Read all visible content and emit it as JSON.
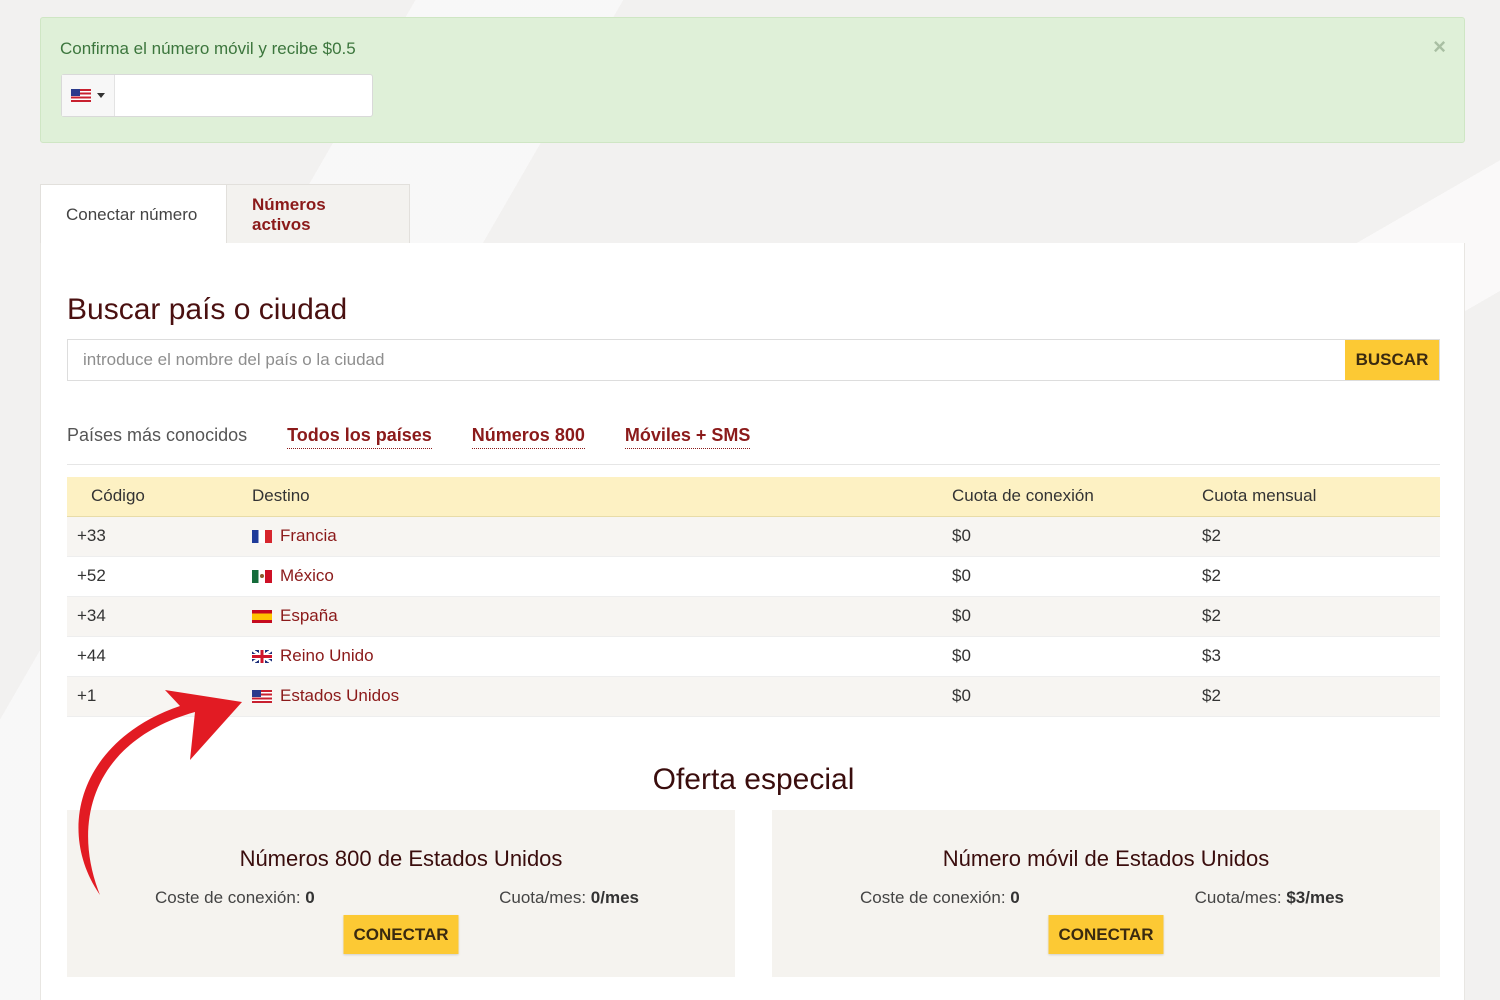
{
  "alert": {
    "message": "Confirma el número móvil y recibe $0.5",
    "close_glyph": "×",
    "phone_value": "",
    "selected_country_flag": "us-flag-icon"
  },
  "tabs": [
    {
      "label": "Conectar número",
      "active": true
    },
    {
      "label": "Números activos",
      "active": false
    }
  ],
  "search": {
    "title": "Buscar país o ciudad",
    "placeholder": "introduce el nombre del país o la ciudad",
    "button_label": "BUSCAR"
  },
  "filters": {
    "label": "Países más conocidos",
    "links": [
      "Todos los países",
      "Números 800",
      "Móviles + SMS"
    ]
  },
  "table": {
    "headers": [
      "Código",
      "Destino",
      "Cuota de conexión",
      "Cuota mensual"
    ],
    "rows": [
      {
        "code": "+33",
        "flag": "fr",
        "destination": "Francia",
        "connection": "$0",
        "monthly": "$2"
      },
      {
        "code": "+52",
        "flag": "mx",
        "destination": "México",
        "connection": "$0",
        "monthly": "$2"
      },
      {
        "code": "+34",
        "flag": "es",
        "destination": "España",
        "connection": "$0",
        "monthly": "$2"
      },
      {
        "code": "+44",
        "flag": "gb",
        "destination": "Reino Unido",
        "connection": "$0",
        "monthly": "$3"
      },
      {
        "code": "+1",
        "flag": "us",
        "destination": "Estados Unidos",
        "connection": "$0",
        "monthly": "$2"
      }
    ]
  },
  "offers": {
    "title": "Oferta especial",
    "cards": [
      {
        "title": "Números 800 de Estados Unidos",
        "conn_label": "Coste de conexión:",
        "conn_value": "0",
        "fee_label": "Cuota/mes:",
        "fee_value": "0/mes",
        "button": "CONECTAR"
      },
      {
        "title": "Número móvil de Estados Unidos",
        "conn_label": "Coste de conexión:",
        "conn_value": "0",
        "fee_label": "Cuota/mes:",
        "fee_value": "$3/mes",
        "button": "CONECTAR"
      }
    ]
  },
  "colors": {
    "accent_dark_red": "#8b1a1a",
    "button_yellow": "#fcc934",
    "alert_green_bg": "#dff0d8",
    "alert_green_text": "#3c763d",
    "table_header_bg": "#fdf1c3",
    "annotation_arrow_red": "#e21b23"
  }
}
